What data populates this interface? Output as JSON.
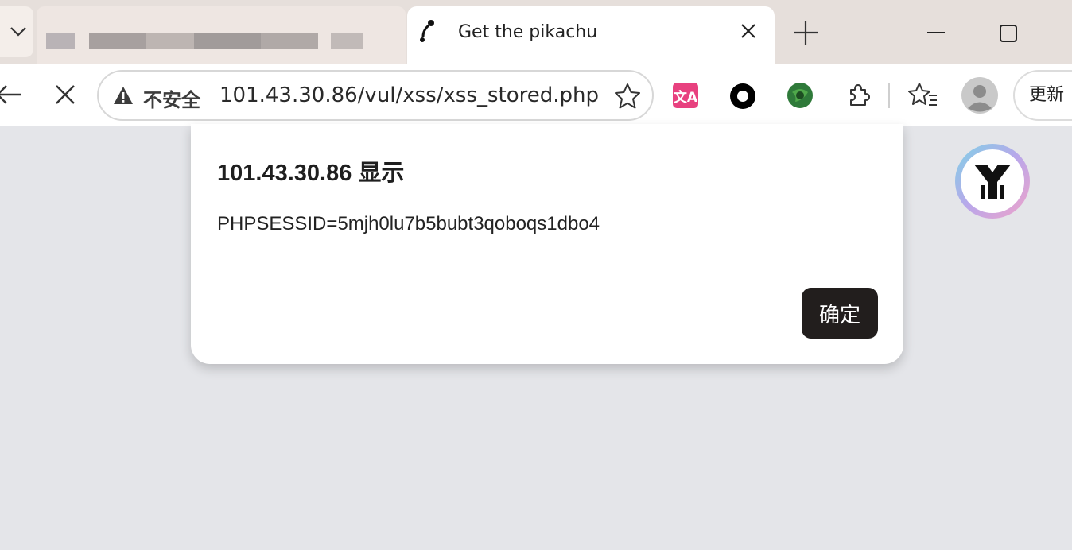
{
  "tabs": {
    "active_title": "Get the pikachu",
    "blurred_tab": "redacted"
  },
  "toolbar": {
    "security_label": "不安全",
    "url": "101.43.30.86/vul/xss/xss_stored.php",
    "update_label": "更新",
    "translate_ext_glyph": "文A"
  },
  "dialog": {
    "title": "101.43.30.86 显示",
    "message": "PHPSESSID=5mjh0lu7b5bubt3qoboqs1dbo4",
    "ok_label": "确定"
  },
  "icons": {
    "back": "back-arrow-icon",
    "stop": "stop-icon",
    "warning": "warning-icon",
    "star": "star-icon",
    "extensions": "puzzle-icon",
    "favorites": "favorites-icon",
    "profile": "profile-avatar-icon",
    "new_tab": "plus-icon",
    "minimize": "minimize-icon",
    "maximize": "maximize-icon"
  },
  "colors": {
    "tabbar_bg": "#e6dfdb",
    "content_bg": "#e4e5e9",
    "ok_button_bg": "#221e1d",
    "translate_ext": "#e8417f"
  }
}
